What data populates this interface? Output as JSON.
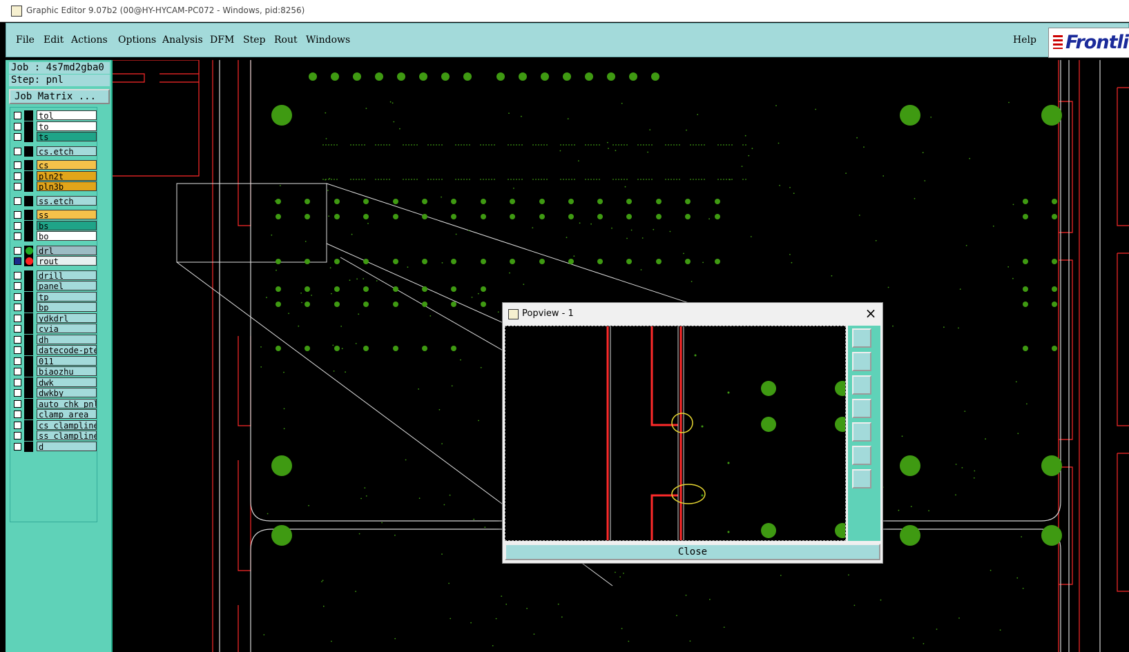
{
  "window": {
    "title": "Graphic Editor 9.07b2 (00@HY-HYCAM-PC072 - Windows, pid:8256)"
  },
  "menu": {
    "items": [
      "File",
      "Edit",
      "Actions",
      "Options",
      "Analysis",
      "DFM",
      "Step",
      "Rout",
      "Windows"
    ],
    "help": "Help"
  },
  "logo": {
    "text": "Frontli"
  },
  "job": {
    "label": "Job : 4s7md2gba0",
    "step": "Step: pnl",
    "matrix_button": "Job Matrix ..."
  },
  "layers": [
    {
      "name": "tol",
      "color": "#ffffff"
    },
    {
      "name": "to",
      "color": "#ffffff"
    },
    {
      "name": "ts",
      "color": "#1fa488"
    },
    {
      "name": "cs.etch",
      "color": "#a3dada"
    },
    {
      "name": "cs",
      "color": "#f4c14a"
    },
    {
      "name": "pln2t",
      "color": "#e2a51a"
    },
    {
      "name": "pln3b",
      "color": "#e2a51a"
    },
    {
      "name": "ss.etch",
      "color": "#a3dada"
    },
    {
      "name": "ss",
      "color": "#f4c14a"
    },
    {
      "name": "bs",
      "color": "#1fa488"
    },
    {
      "name": "bo",
      "color": "#ffffff"
    },
    {
      "name": "drl",
      "color": "#9cbcc4",
      "dot": "#22aa22"
    },
    {
      "name": "rout",
      "color": "#e6f0f0",
      "dot": "#ff2222",
      "selected": true
    },
    {
      "name": "drill",
      "color": "#a3dada"
    },
    {
      "name": "panel",
      "color": "#a3dada"
    },
    {
      "name": "tp",
      "color": "#a3dada"
    },
    {
      "name": "bp",
      "color": "#a3dada"
    },
    {
      "name": "ydkdrl",
      "color": "#a3dada"
    },
    {
      "name": "cvia",
      "color": "#a3dada"
    },
    {
      "name": "dh",
      "color": "#a3dada"
    },
    {
      "name": "datecode-pte",
      "color": "#a3dada"
    },
    {
      "name": "011",
      "color": "#a3dada"
    },
    {
      "name": "biaozhu",
      "color": "#a3dada"
    },
    {
      "name": "dwk",
      "color": "#a3dada"
    },
    {
      "name": "dwkby",
      "color": "#a3dada"
    },
    {
      "name": "auto_chk_pnl",
      "color": "#a3dada"
    },
    {
      "name": "clamp_area",
      "color": "#a3dada"
    },
    {
      "name": "cs_clampline",
      "color": "#a3dada"
    },
    {
      "name": "ss_clampline",
      "color": "#a3dada"
    },
    {
      "name": "d",
      "color": "#a3dada"
    }
  ],
  "popview": {
    "title": "Popview - 1",
    "close_label": "Close"
  },
  "colors": {
    "pad": "#3f9a12",
    "rout": "#ff2a2a",
    "outline": "#e0e0e0",
    "highlight": "#e8d832"
  }
}
